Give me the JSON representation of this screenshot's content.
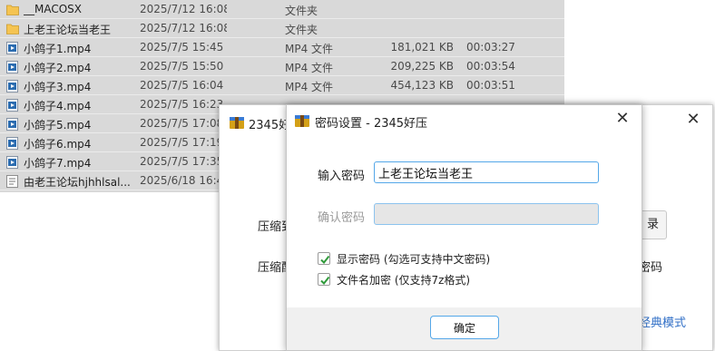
{
  "files": [
    {
      "icon": "folder-icon",
      "name": "__MACOSX",
      "date": "2025/7/12 16:08",
      "type": "文件夹",
      "size": "",
      "duration": ""
    },
    {
      "icon": "folder-icon",
      "name": "上老王论坛当老王",
      "date": "2025/7/12 16:08",
      "type": "文件夹",
      "size": "",
      "duration": ""
    },
    {
      "icon": "video-file-icon",
      "name": "小鸽子1.mp4",
      "date": "2025/7/5 15:45",
      "type": "MP4 文件",
      "size": "181,021 KB",
      "duration": "00:03:27"
    },
    {
      "icon": "video-file-icon",
      "name": "小鸽子2.mp4",
      "date": "2025/7/5 15:50",
      "type": "MP4 文件",
      "size": "209,225 KB",
      "duration": "00:03:54"
    },
    {
      "icon": "video-file-icon",
      "name": "小鸽子3.mp4",
      "date": "2025/7/5 16:04",
      "type": "MP4 文件",
      "size": "454,123 KB",
      "duration": "00:03:51"
    },
    {
      "icon": "video-file-icon",
      "name": "小鸽子4.mp4",
      "date": "2025/7/5 16:23",
      "type": "",
      "size": "",
      "duration": ""
    },
    {
      "icon": "video-file-icon",
      "name": "小鸽子5.mp4",
      "date": "2025/7/5 17:08",
      "type": "",
      "size": "",
      "duration": ""
    },
    {
      "icon": "video-file-icon",
      "name": "小鸽子6.mp4",
      "date": "2025/7/5 17:19",
      "type": "",
      "size": "",
      "duration": ""
    },
    {
      "icon": "video-file-icon",
      "name": "小鸽子7.mp4",
      "date": "2025/7/5 17:35",
      "type": "",
      "size": "",
      "duration": ""
    },
    {
      "icon": "text-file-icon",
      "name": "由老王论坛hjhhlsal...",
      "date": "2025/6/18 16:4",
      "type": "",
      "size": "",
      "duration": ""
    }
  ],
  "back_dialog": {
    "title": "2345好",
    "close": "✕",
    "label1": "压缩到",
    "label2": "压缩配",
    "button": "录",
    "text2": "密码",
    "link": "经典模式"
  },
  "password_dialog": {
    "title": "密码设置 - 2345好压",
    "close": "✕",
    "password_label": "输入密码",
    "password_value": "上老王论坛当老王",
    "confirm_label": "确认密码",
    "confirm_value": "",
    "show_password": {
      "label": "显示密码 (勾选可支持中文密码)",
      "checked": true
    },
    "encrypt_filenames": {
      "label": "文件名加密 (仅支持7z格式)",
      "checked": true
    },
    "ok_label": "确定"
  },
  "colors": {
    "list_background": "#d9d9d9",
    "folder": "#f5c451",
    "video_file": "#2b6cb0",
    "accent": "#54a7e8",
    "check": "#2f9a3a",
    "link": "#2f6ec6"
  }
}
